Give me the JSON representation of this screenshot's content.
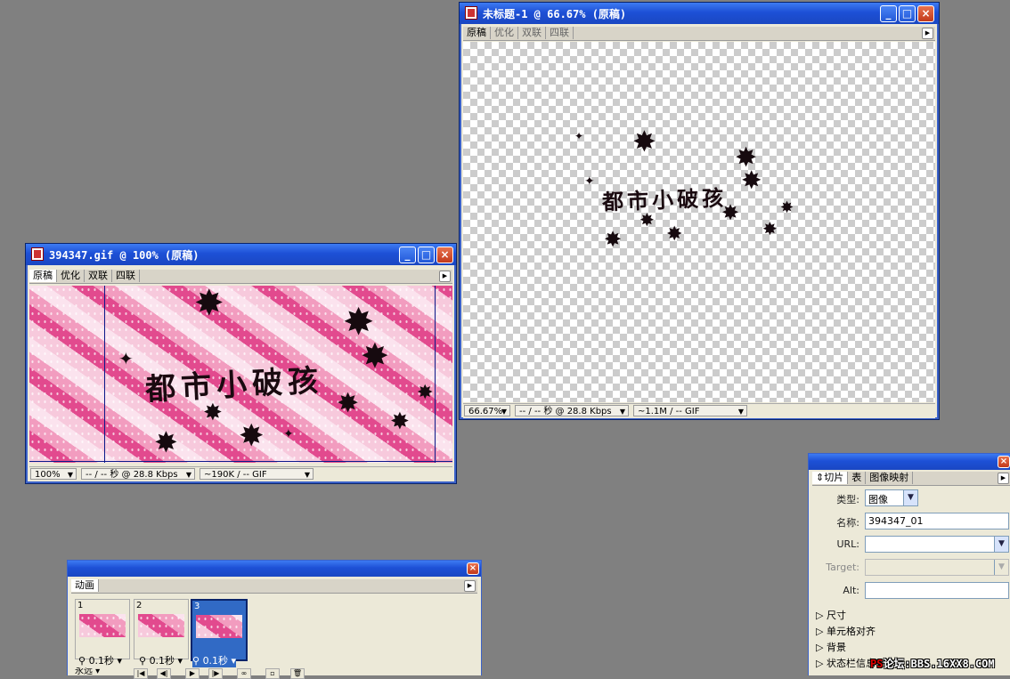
{
  "doc_tabs": [
    "原稿",
    "优化",
    "双联",
    "四联"
  ],
  "artwork": {
    "text": "都市小破孩"
  },
  "window_preview": {
    "title": "394347.gif @ 100% (原稿)",
    "zoom": "100%",
    "speed": "-- / -- 秒 @ 28.8 Kbps",
    "filesize": "~190K / -- GIF"
  },
  "window_untitled": {
    "title": "未标题-1 @ 66.67% (原稿)",
    "zoom": "66.67%",
    "speed": "-- / -- 秒 @ 28.8 Kbps",
    "filesize": "~1.1M / -- GIF"
  },
  "animation_panel": {
    "tab": "动画",
    "frames": [
      {
        "num": "1",
        "delay": "0.1秒",
        "selected": false
      },
      {
        "num": "2",
        "delay": "0.1秒",
        "selected": false
      },
      {
        "num": "3",
        "delay": "0.1秒",
        "selected": true
      }
    ],
    "loop": "永远"
  },
  "slice_panel": {
    "tabs": [
      "切片",
      "表",
      "图像映射"
    ],
    "type_label": "类型:",
    "type_value": "图像",
    "name_label": "名称:",
    "name_value": "394347_01",
    "url_label": "URL:",
    "url_value": "",
    "target_label": "Target:",
    "target_value": "",
    "alt_label": "Alt:",
    "alt_value": "",
    "sections": [
      "尺寸",
      "单元格对齐",
      "背景",
      "状态栏信息"
    ]
  },
  "watermark": {
    "ps": "PS",
    "text": "论坛:BBS.16XX8.COM"
  },
  "colors": {
    "titlebar": "#1d50d6",
    "selection": "#316ac5",
    "workspace": "#808080"
  }
}
